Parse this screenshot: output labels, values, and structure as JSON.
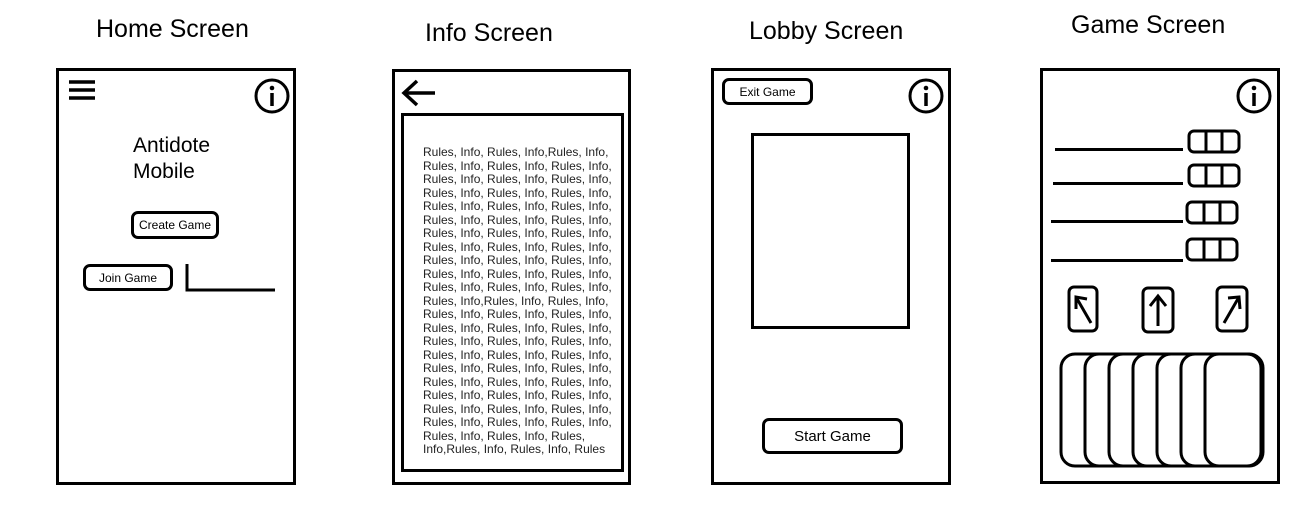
{
  "screens": {
    "home": {
      "title": "Home Screen",
      "app_title_line1": "Antidote",
      "app_title_line2": "Mobile",
      "create_game_label": "Create Game",
      "join_game_label": "Join Game"
    },
    "info": {
      "title": "Info Screen",
      "rules_text": "Rules, Info, Rules, Info,Rules, Info,\nRules, Info, Rules, Info, Rules, Info,\nRules, Info, Rules, Info, Rules, Info,\nRules, Info, Rules, Info, Rules, Info,\nRules, Info, Rules, Info, Rules, Info,\nRules, Info, Rules, Info, Rules, Info,\nRules, Info, Rules, Info, Rules, Info,\nRules, Info, Rules, Info, Rules, Info,\nRules, Info, Rules, Info, Rules, Info,\nRules, Info, Rules, Info, Rules, Info,\nRules, Info, Rules, Info, Rules, Info,\nRules, Info,Rules, Info, Rules, Info,\nRules, Info, Rules, Info, Rules, Info,\nRules, Info, Rules, Info, Rules, Info,\nRules, Info, Rules, Info, Rules, Info,\nRules, Info, Rules, Info, Rules, Info,\nRules, Info, Rules, Info, Rules, Info,\nRules, Info, Rules, Info, Rules, Info,\nRules, Info, Rules, Info, Rules, Info,\nRules, Info, Rules, Info, Rules, Info,\nRules, Info, Rules, Info, Rules, Info,\nRules, Info, Rules, Info, Rules,\nInfo,Rules, Info, Rules, Info, Rules"
    },
    "lobby": {
      "title": "Lobby Screen",
      "exit_game_label": "Exit Game",
      "start_game_label": "Start Game"
    },
    "game": {
      "title": "Game Screen"
    }
  },
  "icons": {
    "menu": "hamburger-menu-icon",
    "info": "info-icon",
    "back": "back-arrow-icon",
    "arrow_up_left": "arrow-up-left-icon",
    "arrow_up": "arrow-up-icon",
    "arrow_up_right": "arrow-up-right-icon"
  }
}
